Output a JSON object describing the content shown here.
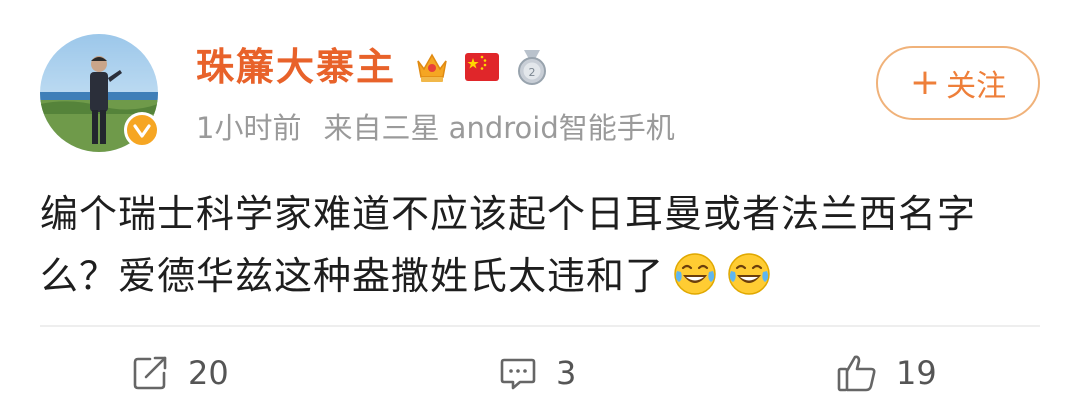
{
  "user": {
    "name": "珠簾大寨主",
    "time": "1小时前",
    "source": "来自三星 android智能手机",
    "badges": [
      "crown-icon",
      "china-flag-icon",
      "medal-icon"
    ],
    "verified_color": "#f6a623"
  },
  "follow": {
    "plus": "+",
    "label": "关注"
  },
  "post": {
    "text": "编个瑞士科学家难道不应该起个日耳曼或者法兰西名字么？爱德华兹这种盎撒姓氏太违和了",
    "emojis": [
      "laughing-crying-emoji",
      "laughing-crying-emoji"
    ]
  },
  "actions": {
    "repost_count": "20",
    "comment_count": "3",
    "like_count": "19"
  },
  "colors": {
    "username": "#e8622a",
    "accent": "#ee7f3a",
    "meta": "#9a9a9a",
    "text": "#1e1e1e"
  }
}
